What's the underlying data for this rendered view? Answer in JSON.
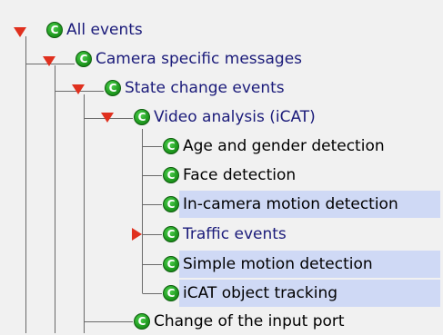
{
  "tree": {
    "nodes": [
      {
        "label": "All events",
        "icon": "C",
        "kind": "group",
        "state": "expanded",
        "selected": false
      },
      {
        "label": "Camera specific messages",
        "icon": "C",
        "kind": "group",
        "state": "expanded",
        "selected": false
      },
      {
        "label": "State change events",
        "icon": "C",
        "kind": "group",
        "state": "expanded",
        "selected": false
      },
      {
        "label": "Video analysis (iCAT)",
        "icon": "C",
        "kind": "group",
        "state": "expanded",
        "selected": false
      },
      {
        "label": "Age and gender detection",
        "icon": "C",
        "kind": "leaf",
        "state": "none",
        "selected": false
      },
      {
        "label": "Face detection",
        "icon": "C",
        "kind": "leaf",
        "state": "none",
        "selected": false
      },
      {
        "label": "In-camera motion detection",
        "icon": "C",
        "kind": "leaf",
        "state": "none",
        "selected": true
      },
      {
        "label": "Traffic events",
        "icon": "C",
        "kind": "group",
        "state": "collapsed",
        "selected": false
      },
      {
        "label": "Simple motion detection",
        "icon": "C",
        "kind": "leaf",
        "state": "none",
        "selected": true
      },
      {
        "label": "iCAT object tracking",
        "icon": "C",
        "kind": "leaf",
        "state": "none",
        "selected": true
      },
      {
        "label": "Change of the input port",
        "icon": "C",
        "kind": "leaf",
        "state": "none",
        "selected": false
      }
    ]
  },
  "colors": {
    "background": "#f1f1f1",
    "selection": "#cfd9f5",
    "expander": "#e0301e",
    "group_text": "#1b1b7a",
    "icon_green": "#1f9a1f"
  }
}
